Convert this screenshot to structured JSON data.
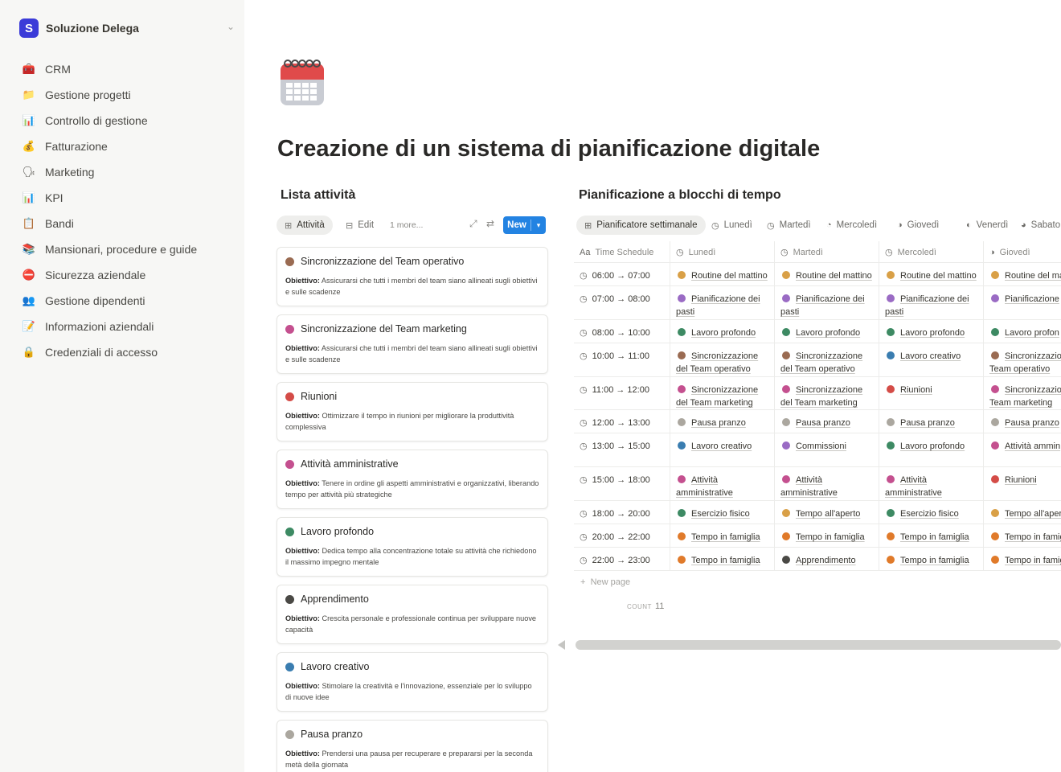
{
  "sidebar": {
    "workspace": {
      "logo": "S",
      "name": "Soluzione Delega",
      "chevron": "⌄"
    },
    "items": [
      {
        "icon": "🧰",
        "icon_name": "toolbox-icon",
        "label": "CRM"
      },
      {
        "icon": "📁",
        "icon_name": "folder-icon",
        "label": "Gestione progetti"
      },
      {
        "icon": "📊",
        "icon_name": "bar-chart-icon",
        "label": "Controllo di gestione"
      },
      {
        "icon": "💰",
        "icon_name": "money-bag-icon",
        "label": "Fatturazione"
      },
      {
        "icon": "🗣",
        "icon_name": "speaking-head-icon",
        "label": "Marketing"
      },
      {
        "icon": "📊",
        "icon_name": "bar-chart-icon",
        "label": "KPI"
      },
      {
        "icon": "📋",
        "icon_name": "clipboard-icon",
        "label": "Bandi"
      },
      {
        "icon": "📚",
        "icon_name": "books-icon",
        "label": "Mansionari, procedure e guide"
      },
      {
        "icon": "⛔",
        "icon_name": "no-entry-icon",
        "label": "Sicurezza aziendale"
      },
      {
        "icon": "👥",
        "icon_name": "people-icon",
        "label": "Gestione dipendenti"
      },
      {
        "icon": "📝",
        "icon_name": "memo-icon",
        "label": "Informazioni aziendali"
      },
      {
        "icon": "🔒",
        "icon_name": "lock-icon",
        "label": "Credenziali di accesso"
      }
    ]
  },
  "page": {
    "icon_name": "calendar-icon",
    "title": "Creazione di un sistema di pianificazione digitale"
  },
  "tasks": {
    "title": "Lista attività",
    "views": {
      "active": "Attività",
      "edit": "Edit",
      "more": "1 more...",
      "new_label": "New"
    },
    "objective_label": "Obiettivo:",
    "cards": [
      {
        "title": "Sincronizzazione del Team operativo",
        "color": "#9a6b52",
        "desc": "Assicurarsi che tutti i membri del team siano allineati sugli obiettivi e sulle scadenze"
      },
      {
        "title": "Sincronizzazione del Team marketing",
        "color": "#c4508f",
        "desc": "Assicurarsi che tutti i membri del team siano allineati sugli obiettivi e sulle scadenze"
      },
      {
        "title": "Riunioni",
        "color": "#d44c47",
        "desc": "Ottimizzare il tempo in riunioni per migliorare la produttività complessiva"
      },
      {
        "title": "Attività amministrative",
        "color": "#c4508f",
        "desc": "Tenere in ordine gli aspetti amministrativi e organizzativi, liberando tempo per attività più strategiche"
      },
      {
        "title": "Lavoro profondo",
        "color": "#3d8a63",
        "desc": "Dedica tempo alla concentrazione totale su attività che richiedono il massimo impegno mentale"
      },
      {
        "title": "Apprendimento",
        "color": "#4a4945",
        "desc": "Crescita personale e professionale continua per sviluppare nuove capacità"
      },
      {
        "title": "Lavoro creativo",
        "color": "#3a7db0",
        "desc": "Stimolare la creatività e l'innovazione, essenziale per lo sviluppo di nuove idee"
      },
      {
        "title": "Pausa pranzo",
        "color": "#aba79f",
        "desc": "Prendersi una pausa per recuperare e prepararsi per la seconda metà della giornata"
      }
    ]
  },
  "schedule": {
    "title": "Pianificazione a blocchi di tempo",
    "tabs": [
      "Pianificatore settimanale",
      "Lunedì",
      "Martedì",
      "Mercoledì",
      "Giovedì",
      "Venerdì",
      "Sabato"
    ],
    "headers": [
      "Time Schedule",
      "Lunedì",
      "Martedì",
      "Mercoledì",
      "Giovedì"
    ],
    "header_icon_text": "Aa",
    "new_page": "New page",
    "count_label": "COUNT",
    "count_value": "11",
    "colors": {
      "routine": "#d9a047",
      "pasti": "#9a6bc4",
      "profondo": "#3d8a63",
      "operativo": "#9a6b52",
      "marketing": "#c4508f",
      "creativo": "#3a7db0",
      "riunioni": "#d44c47",
      "pranzo": "#aba79f",
      "commissioni": "#9a6bc4",
      "admin": "#c4508f",
      "fisico": "#3d8a63",
      "aperto": "#d9a047",
      "famiglia": "#e07a2a",
      "apprendimento": "#4a4945"
    },
    "rows": [
      {
        "time": "06:00 → 07:00",
        "h": 29,
        "cells": [
          {
            "text": "Routine del mattino",
            "c": "routine"
          },
          {
            "text": "Routine del mattino",
            "c": "routine"
          },
          {
            "text": "Routine del mattino",
            "c": "routine"
          },
          {
            "text": "Routine del ma",
            "c": "routine"
          }
        ]
      },
      {
        "time": "07:00 → 08:00",
        "h": 42,
        "cells": [
          {
            "text": "Pianificazione dei pasti",
            "c": "pasti"
          },
          {
            "text": "Pianificazione dei pasti",
            "c": "pasti"
          },
          {
            "text": "Pianificazione dei pasti",
            "c": "pasti"
          },
          {
            "text": "Pianificazione",
            "c": "pasti"
          }
        ]
      },
      {
        "time": "08:00 → 10:00",
        "h": 29,
        "cells": [
          {
            "text": "Lavoro profondo",
            "c": "profondo"
          },
          {
            "text": "Lavoro profondo",
            "c": "profondo"
          },
          {
            "text": "Lavoro profondo",
            "c": "profondo"
          },
          {
            "text": "Lavoro profon",
            "c": "profondo"
          }
        ]
      },
      {
        "time": "10:00 → 11:00",
        "h": 42,
        "cells": [
          {
            "text": "Sincronizzazione del Team operativo",
            "c": "operativo"
          },
          {
            "text": "Sincronizzazione del Team operativo",
            "c": "operativo"
          },
          {
            "text": "Lavoro creativo",
            "c": "creativo"
          },
          {
            "text": "Sincronizzazio Team operativo",
            "c": "operativo"
          }
        ]
      },
      {
        "time": "11:00 → 12:00",
        "h": 41,
        "cells": [
          {
            "text": "Sincronizzazione del Team marketing",
            "c": "marketing"
          },
          {
            "text": "Sincronizzazione del Team marketing",
            "c": "marketing"
          },
          {
            "text": "Riunioni",
            "c": "riunioni"
          },
          {
            "text": "Sincronizzazio Team marketing",
            "c": "marketing"
          }
        ]
      },
      {
        "time": "12:00 → 13:00",
        "h": 29,
        "cells": [
          {
            "text": "Pausa pranzo",
            "c": "pranzo"
          },
          {
            "text": "Pausa pranzo",
            "c": "pranzo"
          },
          {
            "text": "Pausa pranzo",
            "c": "pranzo"
          },
          {
            "text": "Pausa pranzo",
            "c": "pranzo"
          }
        ]
      },
      {
        "time": "13:00 → 15:00",
        "h": 42,
        "cells": [
          {
            "text": "Lavoro creativo",
            "c": "creativo"
          },
          {
            "text": "Commissioni",
            "c": "commissioni"
          },
          {
            "text": "Lavoro profondo",
            "c": "profondo"
          },
          {
            "text": "Attività ammin",
            "c": "admin"
          }
        ]
      },
      {
        "time": "15:00 → 18:00",
        "h": 42,
        "cells": [
          {
            "text": "Attività amministrative",
            "c": "admin"
          },
          {
            "text": "Attività amministrative",
            "c": "admin"
          },
          {
            "text": "Attività amministrative",
            "c": "admin"
          },
          {
            "text": "Riunioni",
            "c": "riunioni"
          }
        ]
      },
      {
        "time": "18:00 → 20:00",
        "h": 29,
        "cells": [
          {
            "text": "Esercizio fisico",
            "c": "fisico"
          },
          {
            "text": "Tempo all'aperto",
            "c": "aperto"
          },
          {
            "text": "Esercizio fisico",
            "c": "fisico"
          },
          {
            "text": "Tempo all'aper",
            "c": "aperto"
          }
        ]
      },
      {
        "time": "20:00 → 22:00",
        "h": 29,
        "cells": [
          {
            "text": "Tempo in famiglia",
            "c": "famiglia"
          },
          {
            "text": "Tempo in famiglia",
            "c": "famiglia"
          },
          {
            "text": "Tempo in famiglia",
            "c": "famiglia"
          },
          {
            "text": "Tempo in famig",
            "c": "famiglia"
          }
        ]
      },
      {
        "time": "22:00 → 23:00",
        "h": 29,
        "cells": [
          {
            "text": "Tempo in famiglia",
            "c": "famiglia"
          },
          {
            "text": "Apprendimento",
            "c": "apprendimento"
          },
          {
            "text": "Tempo in famiglia",
            "c": "famiglia"
          },
          {
            "text": "Tempo in famig",
            "c": "famiglia"
          }
        ]
      }
    ]
  }
}
